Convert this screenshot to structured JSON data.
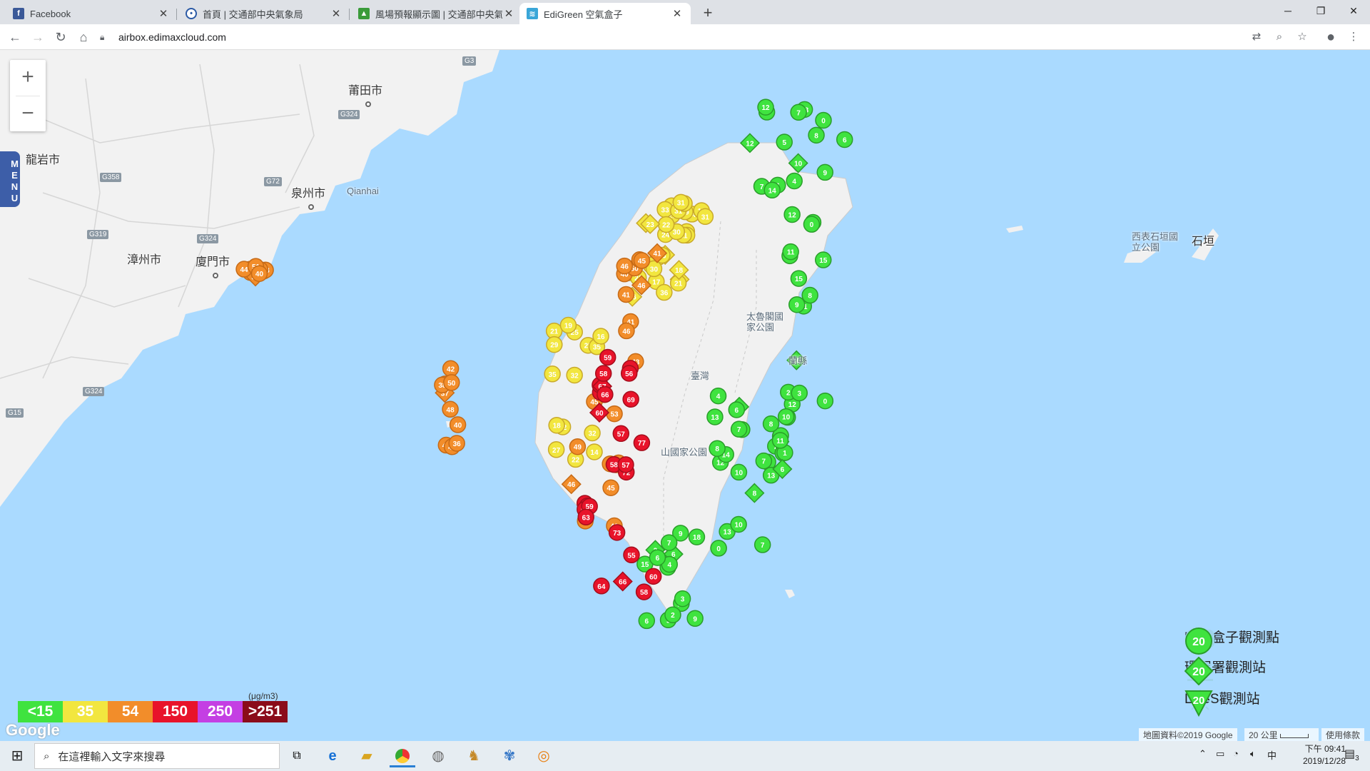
{
  "tabs": [
    {
      "title": "Facebook",
      "icon": "facebook-icon",
      "color": "#3b5998",
      "glyph": "f",
      "active": false
    },
    {
      "title": "首頁 | 交通部中央氣象局",
      "icon": "cwb-icon",
      "color": "#2b5aa5",
      "glyph": "◉",
      "active": false
    },
    {
      "title": "風場預報顯示圖 | 交通部中央氣象",
      "icon": "map-icon",
      "color": "#3a9b3a",
      "glyph": "▲",
      "active": false
    },
    {
      "title": "EdiGreen 空氣盒子",
      "icon": "airbox-icon",
      "color": "#39a6d8",
      "glyph": "≋",
      "active": true
    }
  ],
  "url": "airbox.edimaxcloud.com",
  "menu_label": "MENU",
  "cities": [
    {
      "name": "莆田市"
    },
    {
      "name": "龍岩市"
    },
    {
      "name": "泉州市"
    },
    {
      "name": "Qianhai"
    },
    {
      "name": "漳州市"
    },
    {
      "name": "廈門市"
    },
    {
      "name": "西表石垣國立公園"
    },
    {
      "name": "石垣"
    },
    {
      "name": "太魯閣國家公園"
    },
    {
      "name": "山國家公園"
    },
    {
      "name": "蘭縣"
    },
    {
      "name": "臺灣"
    }
  ],
  "roads": [
    "G3",
    "G324",
    "G358",
    "G72",
    "G319",
    "G324",
    "G15",
    "G324"
  ],
  "scale": {
    "unit": "(μg/m3)",
    "levels": [
      {
        "label": "<15",
        "color": "#3fe33f"
      },
      {
        "label": "35",
        "color": "#f2e63f"
      },
      {
        "label": "54",
        "color": "#f28d2a"
      },
      {
        "label": "150",
        "color": "#e8132a"
      },
      {
        "label": "250",
        "color": "#c43fe3"
      },
      {
        "label": ">251",
        "color": "#8b0c1a"
      }
    ]
  },
  "legend": [
    {
      "label": "空氣盒子觀測點",
      "marker_value": "20",
      "marker": "circle"
    },
    {
      "label": "環保署觀測站",
      "marker_value": "20",
      "marker": "diamond"
    },
    {
      "label": "LASS觀測站",
      "marker_value": "20",
      "marker": "triangle"
    }
  ],
  "google_label": "Google",
  "attribution": {
    "map_data": "地圖資料©2019 Google",
    "scale_text": "20 公里",
    "terms": "使用條款"
  },
  "markers": {
    "green": [
      10,
      6,
      10,
      6,
      4,
      6,
      3,
      5,
      9,
      8,
      9,
      0,
      12,
      18,
      7,
      8,
      12,
      7,
      6,
      6,
      5,
      2,
      13,
      7,
      8,
      9,
      11,
      12,
      15,
      9,
      6,
      11,
      10,
      13,
      8,
      0,
      10,
      7,
      9,
      1,
      13,
      15,
      14,
      12,
      13,
      12,
      8,
      0,
      9,
      11,
      7,
      15,
      13,
      3,
      6,
      14,
      12,
      4,
      2,
      5,
      7,
      9,
      8,
      2,
      10,
      12,
      0,
      6,
      4,
      7,
      4,
      3,
      8,
      6
    ],
    "yellow": [
      16,
      21,
      31,
      19,
      32,
      38,
      26,
      27,
      24,
      10,
      22,
      15,
      17,
      14,
      33,
      36,
      25,
      31,
      16,
      32,
      29,
      21,
      35,
      31,
      24,
      25,
      26,
      28,
      28,
      33,
      21,
      32,
      30,
      26,
      35,
      31,
      18,
      29,
      26,
      33,
      19,
      22,
      30,
      16,
      31,
      23,
      18
    ],
    "orange": [
      41,
      45,
      36,
      50,
      41,
      49,
      43,
      38,
      40,
      46,
      45,
      37,
      50,
      44,
      40,
      38,
      46,
      49,
      37,
      39,
      41,
      45,
      48,
      54,
      46,
      38,
      36,
      39,
      50,
      53,
      38,
      44,
      43,
      47,
      42,
      51,
      46,
      49,
      50,
      40,
      45
    ],
    "red": [
      60,
      58,
      71,
      59,
      57,
      60,
      59,
      58,
      77,
      66,
      98,
      72,
      69,
      64,
      56,
      55,
      65,
      62,
      67,
      73,
      57,
      61,
      58,
      59,
      66,
      63
    ]
  },
  "taskbar": {
    "search_placeholder": "在這裡輸入文字來搜尋",
    "time": "下午 09:41",
    "date": "2019/12/28",
    "ime": "中",
    "notifications": "3"
  }
}
